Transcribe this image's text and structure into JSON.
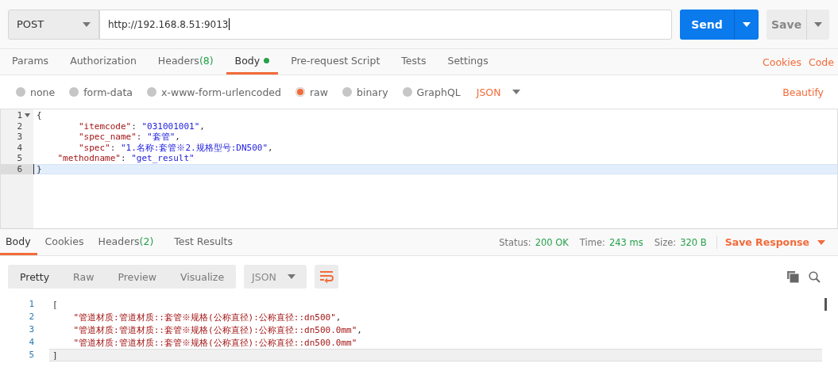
{
  "request": {
    "method": "POST",
    "url": "http://192.168.8.51:9013",
    "send": "Send",
    "save": "Save"
  },
  "request_tabs": [
    {
      "label": "Params",
      "selected": false
    },
    {
      "label": "Authorization",
      "selected": false
    },
    {
      "label": "Headers",
      "count": "(8)",
      "selected": false
    },
    {
      "label": "Body",
      "dot": true,
      "selected": true
    },
    {
      "label": "Pre-request Script",
      "selected": false
    },
    {
      "label": "Tests",
      "selected": false
    },
    {
      "label": "Settings",
      "selected": false
    }
  ],
  "request_links": [
    "Cookies",
    "Code"
  ],
  "body_types": [
    {
      "label": "none",
      "selected": false
    },
    {
      "label": "form-data",
      "selected": false
    },
    {
      "label": "x-www-form-urlencoded",
      "selected": false
    },
    {
      "label": "raw",
      "selected": true
    },
    {
      "label": "binary",
      "selected": false
    },
    {
      "label": "GraphQL",
      "selected": false
    }
  ],
  "body_format": "JSON",
  "beautify": "Beautify",
  "request_body": [
    {
      "number": "1",
      "fold": true,
      "current": false,
      "tokens": [
        {
          "kind": "punct",
          "text": "{"
        }
      ]
    },
    {
      "number": "2",
      "fold": false,
      "current": false,
      "tokens": [
        {
          "kind": "key",
          "text": "        \"itemcode\""
        },
        {
          "kind": "punct",
          "text": ": "
        },
        {
          "kind": "string",
          "text": "\"031001001\""
        },
        {
          "kind": "punct",
          "text": ","
        }
      ]
    },
    {
      "number": "3",
      "fold": false,
      "current": false,
      "tokens": [
        {
          "kind": "key",
          "text": "        \"spec_name\""
        },
        {
          "kind": "punct",
          "text": ": "
        },
        {
          "kind": "string",
          "text": "\"套管\""
        },
        {
          "kind": "punct",
          "text": ","
        }
      ]
    },
    {
      "number": "4",
      "fold": false,
      "current": false,
      "tokens": [
        {
          "kind": "key",
          "text": "        \"spec\""
        },
        {
          "kind": "punct",
          "text": ": "
        },
        {
          "kind": "string",
          "text": "\"1.名称:套管※2.规格型号:DN500\""
        },
        {
          "kind": "punct",
          "text": ","
        }
      ]
    },
    {
      "number": "5",
      "fold": false,
      "current": false,
      "tokens": [
        {
          "kind": "key",
          "text": "    \"methodname\""
        },
        {
          "kind": "punct",
          "text": ": "
        },
        {
          "kind": "string",
          "text": "\"get_result\""
        }
      ]
    },
    {
      "number": "6",
      "fold": false,
      "current": true,
      "tokens": [
        {
          "kind": "punct",
          "text": "}"
        }
      ]
    }
  ],
  "response_tabs": [
    {
      "label": "Body",
      "selected": true
    },
    {
      "label": "Cookies",
      "selected": false
    },
    {
      "label": "Headers",
      "count": "(2)",
      "selected": false
    },
    {
      "label": "Test Results",
      "selected": false
    }
  ],
  "response_meta": [
    {
      "label": "Status:",
      "value": "200 OK"
    },
    {
      "label": "Time:",
      "value": "243 ms"
    },
    {
      "label": "Size:",
      "value": "320 B"
    }
  ],
  "save_response": "Save Response",
  "view_modes": [
    {
      "label": "Pretty",
      "selected": true
    },
    {
      "label": "Raw",
      "selected": false
    },
    {
      "label": "Preview",
      "selected": false
    },
    {
      "label": "Visualize",
      "selected": false
    }
  ],
  "response_format": "JSON",
  "response_body": [
    {
      "number": "1",
      "current": false,
      "tokens": [
        {
          "kind": "punct",
          "text": "["
        }
      ]
    },
    {
      "number": "2",
      "current": false,
      "tokens": [
        {
          "kind": "rstring",
          "text": "    \"管道材质:管道材质::套管※规格(公称直径):公称直径::dn500\""
        },
        {
          "kind": "punct",
          "text": ","
        }
      ]
    },
    {
      "number": "3",
      "current": false,
      "tokens": [
        {
          "kind": "rstring",
          "text": "    \"管道材质:管道材质::套管※规格(公称直径):公称直径::dn500.0mm\""
        },
        {
          "kind": "punct",
          "text": ","
        }
      ]
    },
    {
      "number": "4",
      "current": false,
      "tokens": [
        {
          "kind": "rstring",
          "text": "    \"管道材质:管道材质::套管※规格(公称直径):公称直径::dn500.0mm\""
        }
      ]
    },
    {
      "number": "5",
      "current": true,
      "tokens": [
        {
          "kind": "punct",
          "text": "]"
        }
      ]
    }
  ]
}
